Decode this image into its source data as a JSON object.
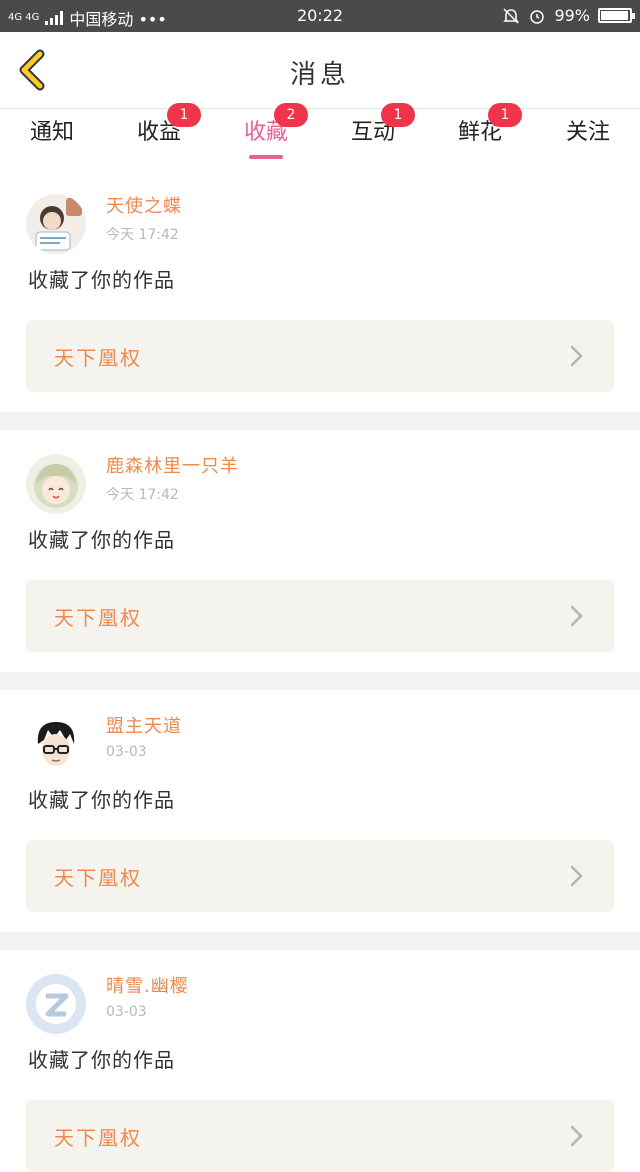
{
  "status_bar": {
    "network": "4G 4G",
    "carrier": "中国移动 •••",
    "time": "20:22",
    "battery": "99%",
    "battery_level": 0.99,
    "icons": [
      "signal-icon",
      "mute-bell-icon",
      "alarm-icon",
      "battery-icon"
    ]
  },
  "header": {
    "back_icon": "chevron-left-icon",
    "title": "消息"
  },
  "tabs": [
    {
      "label": "通知",
      "badge": ""
    },
    {
      "label": "收益",
      "badge": "1"
    },
    {
      "label": "收藏",
      "badge": "2",
      "active": true
    },
    {
      "label": "互动",
      "badge": "1"
    },
    {
      "label": "鲜花",
      "badge": "1"
    },
    {
      "label": "关注",
      "badge": ""
    }
  ],
  "colors": {
    "accent": "#e46296",
    "badge": "#f0344a",
    "username": "#ef8a4f",
    "work_bg": "#f4f3ee",
    "status_bar": "#4a4a4a"
  },
  "feed": [
    {
      "user": "天使之蝶",
      "time": "今天 17:42",
      "action": "收藏了你的作品",
      "work_title": "天下凰权"
    },
    {
      "user": "鹿森林里一只羊",
      "time": "今天 17:42",
      "action": "收藏了你的作品",
      "work_title": "天下凰权"
    },
    {
      "user": "盟主天道",
      "time": "03-03",
      "action": "收藏了你的作品",
      "work_title": "天下凰权"
    },
    {
      "user": "晴雪.幽樱",
      "time": "03-03",
      "action": "收藏了你的作品",
      "work_title": "天下凰权"
    }
  ]
}
